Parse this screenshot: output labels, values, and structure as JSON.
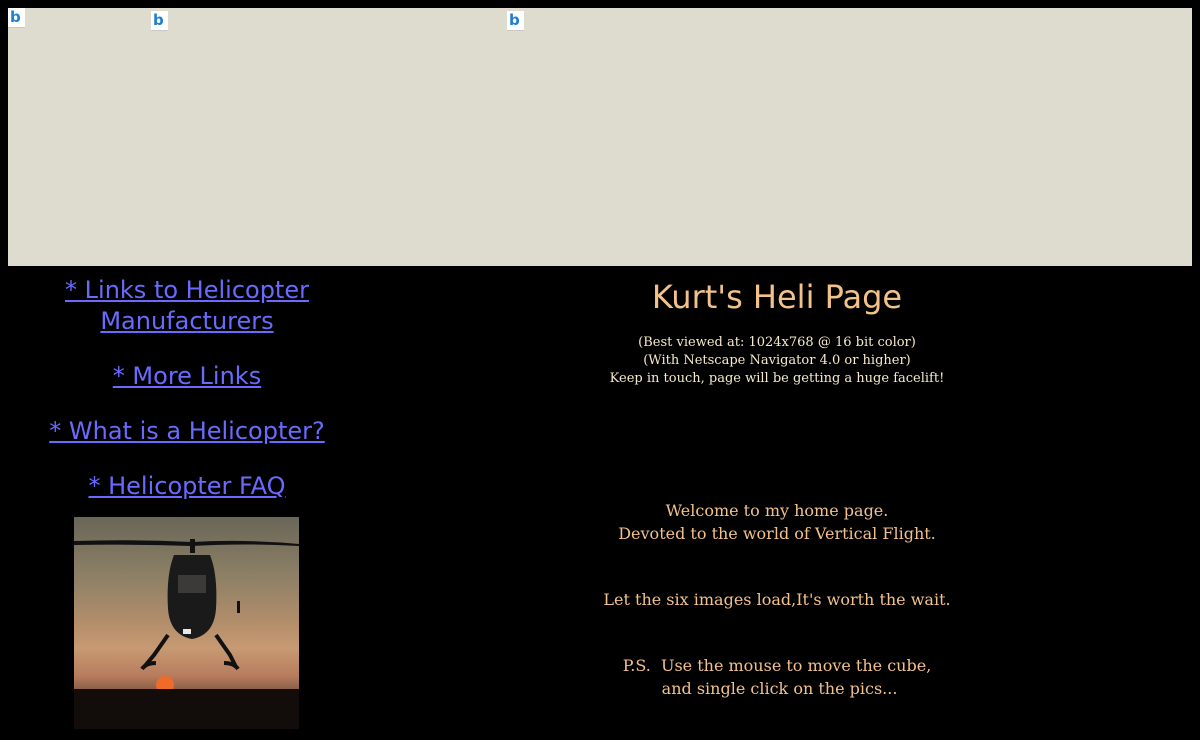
{
  "header_area": {
    "broken_icon_glyph": "b"
  },
  "nav": {
    "links": [
      {
        "label_line1": "* Links to Helicopter",
        "label_line2": "Manufacturers"
      },
      {
        "label": "* More Links"
      },
      {
        "label": "* What is a Helicopter?"
      },
      {
        "label": "* Helicopter FAQ"
      }
    ]
  },
  "main": {
    "title": "Kurt's Heli Page",
    "notes": [
      "(Best viewed at: 1024x768 @ 16 bit color)",
      "(With Netscape Navigator 4.0 or higher)",
      "Keep in touch, page will be getting a huge facelift!"
    ],
    "welcome_line1": "Welcome to my home page.",
    "welcome_line2": "Devoted to the world of Vertical Flight.",
    "images_line": "Let the six images load,It's worth the wait.",
    "ps_line1": "P.S.  Use the mouse to move the cube,",
    "ps_line2": " and single click on the pics..."
  },
  "colors": {
    "background": "#000000",
    "link": "#6a6aff",
    "title": "#f3c28a",
    "applet_bg": "#dedbcf"
  }
}
